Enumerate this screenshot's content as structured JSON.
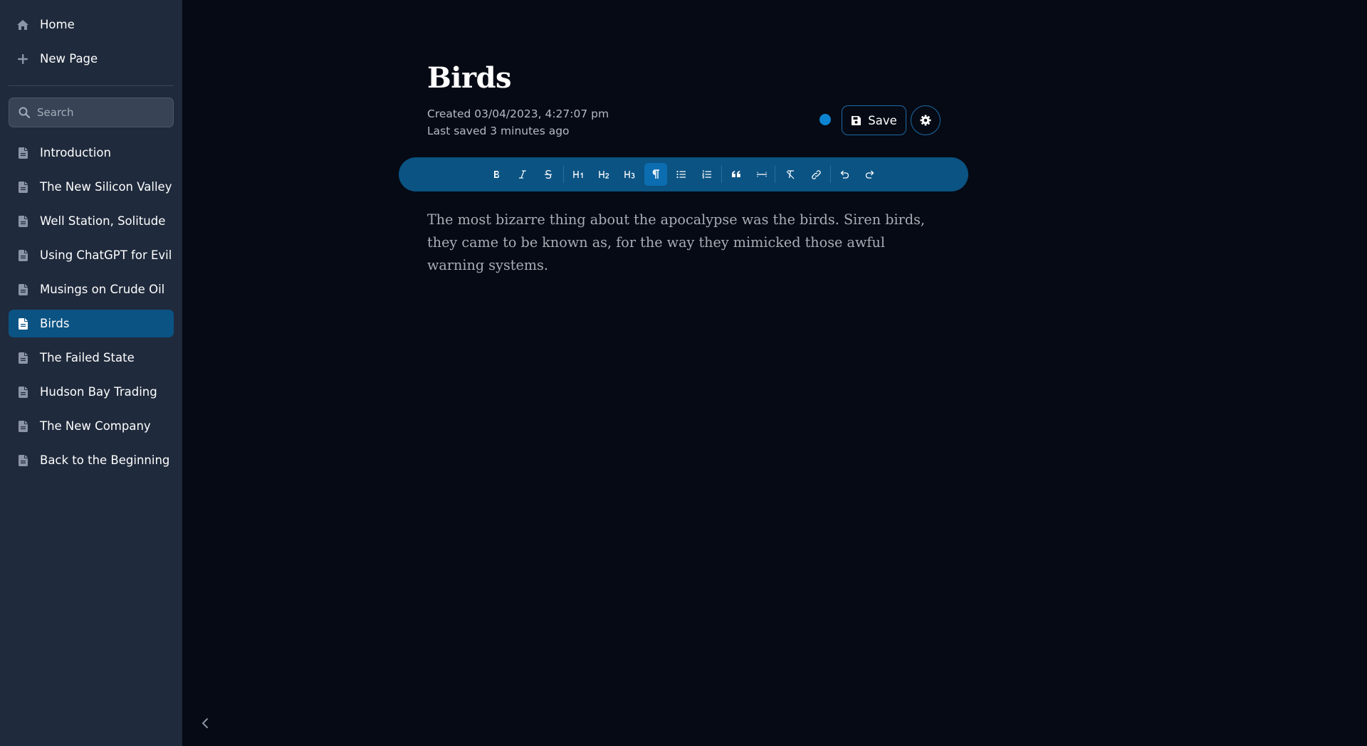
{
  "sidebar": {
    "home_label": "Home",
    "new_page_label": "New Page",
    "search_placeholder": "Search",
    "pages": [
      {
        "label": "Introduction",
        "active": false
      },
      {
        "label": "The New Silicon Valley",
        "active": false
      },
      {
        "label": "Well Station, Solitude",
        "active": false
      },
      {
        "label": "Using ChatGPT for Evil",
        "active": false
      },
      {
        "label": "Musings on Crude Oil",
        "active": false
      },
      {
        "label": "Birds",
        "active": true
      },
      {
        "label": "The Failed State",
        "active": false
      },
      {
        "label": "Hudson Bay Trading",
        "active": false
      },
      {
        "label": "The New Company",
        "active": false
      },
      {
        "label": "Back to the Beginning",
        "active": false
      }
    ]
  },
  "page": {
    "title": "Birds",
    "created": "Created 03/04/2023, 4:27:07 pm",
    "last_saved": "Last saved 3 minutes ago",
    "save_label": "Save",
    "body": "The most bizarre thing about the apocalypse was the birds. Siren birds, they came to be known as, for the way they mimicked those awful warning systems."
  },
  "toolbar": {
    "active_tool": "paragraph",
    "tools": [
      "bold",
      "italic",
      "strikethrough",
      "heading-1",
      "heading-2",
      "heading-3",
      "paragraph",
      "bullet-list",
      "ordered-list",
      "blockquote",
      "horizontal-rule",
      "clear-formatting",
      "link",
      "undo",
      "redo"
    ]
  },
  "colors": {
    "background": "#050a14",
    "sidebar": "#1f2a3c",
    "accent": "#0b5383",
    "status_dot": "#0c84d1"
  }
}
